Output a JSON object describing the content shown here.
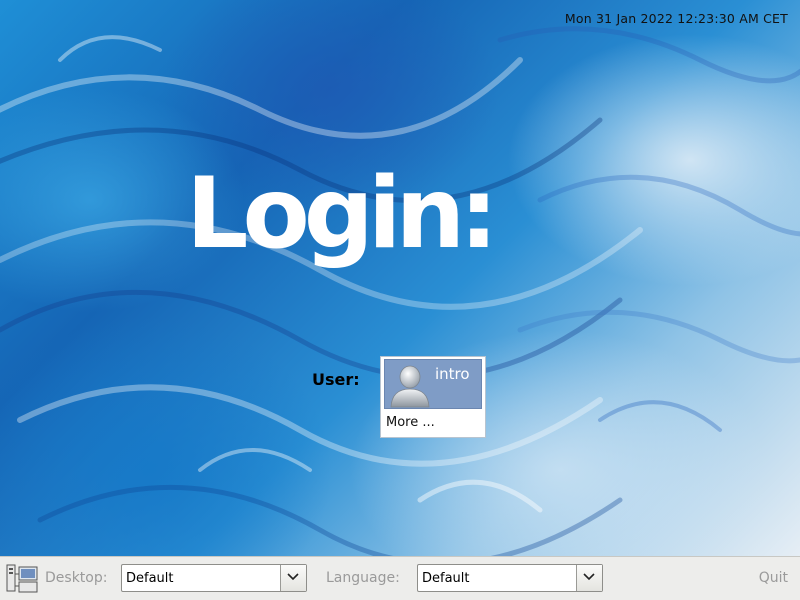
{
  "clock": "Mon 31 Jan 2022 12:23:30 AM CET",
  "login": {
    "title": "Login:",
    "user_label": "User:",
    "users": [
      {
        "name": "intro",
        "icon": "user-avatar-icon"
      }
    ],
    "more_label": "More ..."
  },
  "bottom_bar": {
    "session_icon": "session-icon",
    "desktop_label": "Desktop:",
    "desktop_value": "Default",
    "language_label": "Language:",
    "language_value": "Default",
    "quit_label": "Quit"
  },
  "colors": {
    "selected_user_bg": "#7f9cc6",
    "bar_bg": "#ededeb",
    "title_text": "#ffffff"
  }
}
